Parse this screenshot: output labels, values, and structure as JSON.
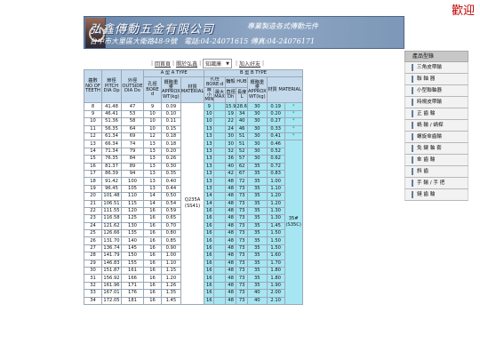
{
  "welcome": "歡迎",
  "company": {
    "name": "弘鑫傳動五金有限公司",
    "slogan": "專業製造各式傳動元件",
    "contact": "台中市大里區大衛路48-9號　電話:04-24071615 傳真:04-24076171"
  },
  "topnav": {
    "home": "回首頁",
    "about": "關於弘鑫",
    "select_value": "知識庫",
    "join": "加入好友"
  },
  "table": {
    "headers": {
      "no": "齒數 NO OF TEETH",
      "pitch": "節徑 PITCH DIA Dp",
      "outside": "外徑 OUTSIDE DIA Do",
      "a_type": "A 型 A TYPE",
      "b_type": "B 型 B TYPE",
      "bore": "孔徑 BORE d",
      "weight": "概略重量 APPROX WT(kg)",
      "material": "材質 MATERIAL",
      "bore_b": "孔徑 BORE:d",
      "hub": "輪殼 HUB",
      "min": "最小 MIN",
      "max": "最大 MAX",
      "dh": "直徑 Dh",
      "l": "長度 L"
    },
    "rows": [
      [
        "8",
        "41.48",
        "47",
        "9",
        "0.09",
        "9",
        "15.9",
        "28.6",
        "30",
        "0.19"
      ],
      [
        "9",
        "46.41",
        "53",
        "10",
        "0.10",
        "10",
        "19",
        "34",
        "30",
        "0.20"
      ],
      [
        "10",
        "51.36",
        "58",
        "10",
        "0.11",
        "10",
        "22",
        "40",
        "30",
        "0.27"
      ],
      [
        "11",
        "56.35",
        "64",
        "10",
        "0.15",
        "13",
        "24",
        "46",
        "30",
        "0.33"
      ],
      [
        "12",
        "61.34",
        "69",
        "12",
        "0.18",
        "13",
        "30",
        "51",
        "30",
        "0.41"
      ],
      [
        "13",
        "66.34",
        "74",
        "13",
        "0.18",
        "13",
        "30",
        "51",
        "30",
        "0.46"
      ],
      [
        "14",
        "71.34",
        "79",
        "13",
        "0.20",
        "13",
        "32",
        "52",
        "30",
        "0.52"
      ],
      [
        "15",
        "76.35",
        "84",
        "13",
        "0.26",
        "13",
        "36",
        "57",
        "30",
        "0.62"
      ],
      [
        "16",
        "81.37",
        "89",
        "13",
        "0.30",
        "13",
        "40",
        "62",
        "35",
        "0.72"
      ],
      [
        "17",
        "86.39",
        "94",
        "13",
        "0.35",
        "13",
        "42",
        "67",
        "35",
        "0.83"
      ],
      [
        "18",
        "91.42",
        "100",
        "13",
        "0.40",
        "13",
        "48",
        "72",
        "35",
        "1.00"
      ],
      [
        "19",
        "96.45",
        "105",
        "13",
        "0.44",
        "13",
        "48",
        "73",
        "35",
        "1.10"
      ],
      [
        "20",
        "101.48",
        "110",
        "14",
        "0.50",
        "14",
        "48",
        "73",
        "35",
        "1.20"
      ],
      [
        "21",
        "106.51",
        "115",
        "14",
        "0.54",
        "14",
        "48",
        "73",
        "35",
        "1.20"
      ],
      [
        "22",
        "111.55",
        "120",
        "16",
        "0.59",
        "16",
        "48",
        "73",
        "35",
        "1.30"
      ],
      [
        "23",
        "116.58",
        "125",
        "16",
        "0.65",
        "16",
        "48",
        "73",
        "35",
        "1.30"
      ],
      [
        "24",
        "121.62",
        "130",
        "16",
        "0.70",
        "16",
        "48",
        "73",
        "35",
        "1.45"
      ],
      [
        "25",
        "126.66",
        "135",
        "16",
        "0.80",
        "16",
        "48",
        "73",
        "35",
        "1.50"
      ],
      [
        "26",
        "131.70",
        "140",
        "16",
        "0.85",
        "16",
        "48",
        "73",
        "35",
        "1.50"
      ],
      [
        "27",
        "136.74",
        "145",
        "16",
        "0.90",
        "16",
        "48",
        "73",
        "35",
        "1.50"
      ],
      [
        "28",
        "141.79",
        "150",
        "16",
        "1.00",
        "16",
        "48",
        "73",
        "35",
        "1.60"
      ],
      [
        "29",
        "146.83",
        "155",
        "16",
        "1.10",
        "16",
        "48",
        "73",
        "35",
        "1.70"
      ],
      [
        "30",
        "151.87",
        "161",
        "16",
        "1.15",
        "16",
        "48",
        "73",
        "35",
        "1.80"
      ],
      [
        "31",
        "156.92",
        "166",
        "16",
        "1.20",
        "16",
        "48",
        "73",
        "35",
        "1.80"
      ],
      [
        "32",
        "161.96",
        "171",
        "16",
        "1.26",
        "16",
        "48",
        "73",
        "35",
        "1.90"
      ],
      [
        "33",
        "167.01",
        "176",
        "16",
        "1.35",
        "16",
        "48",
        "73",
        "40",
        "2.00"
      ],
      [
        "34",
        "172.05",
        "181",
        "16",
        "1.45",
        "16",
        "48",
        "73",
        "40",
        "2.10"
      ]
    ],
    "mat_a": "Q235A (SS41)",
    "mat_b": "35# (S35C)",
    "star": "*"
  },
  "sidebar": {
    "title": "產品型錄",
    "items": [
      "三角皮帶輪",
      "聯 軸 器",
      "小型聯軸器",
      "時規皮帶輪",
      "正 齒 輪",
      "蝸 輪 / 蝸桿",
      "螺旋傘齒輪",
      "免 鍵 軸 套",
      "傘 齒 輪",
      "斜 齒",
      "手 輪 / 手 把",
      "鏈 齒 輪"
    ]
  }
}
